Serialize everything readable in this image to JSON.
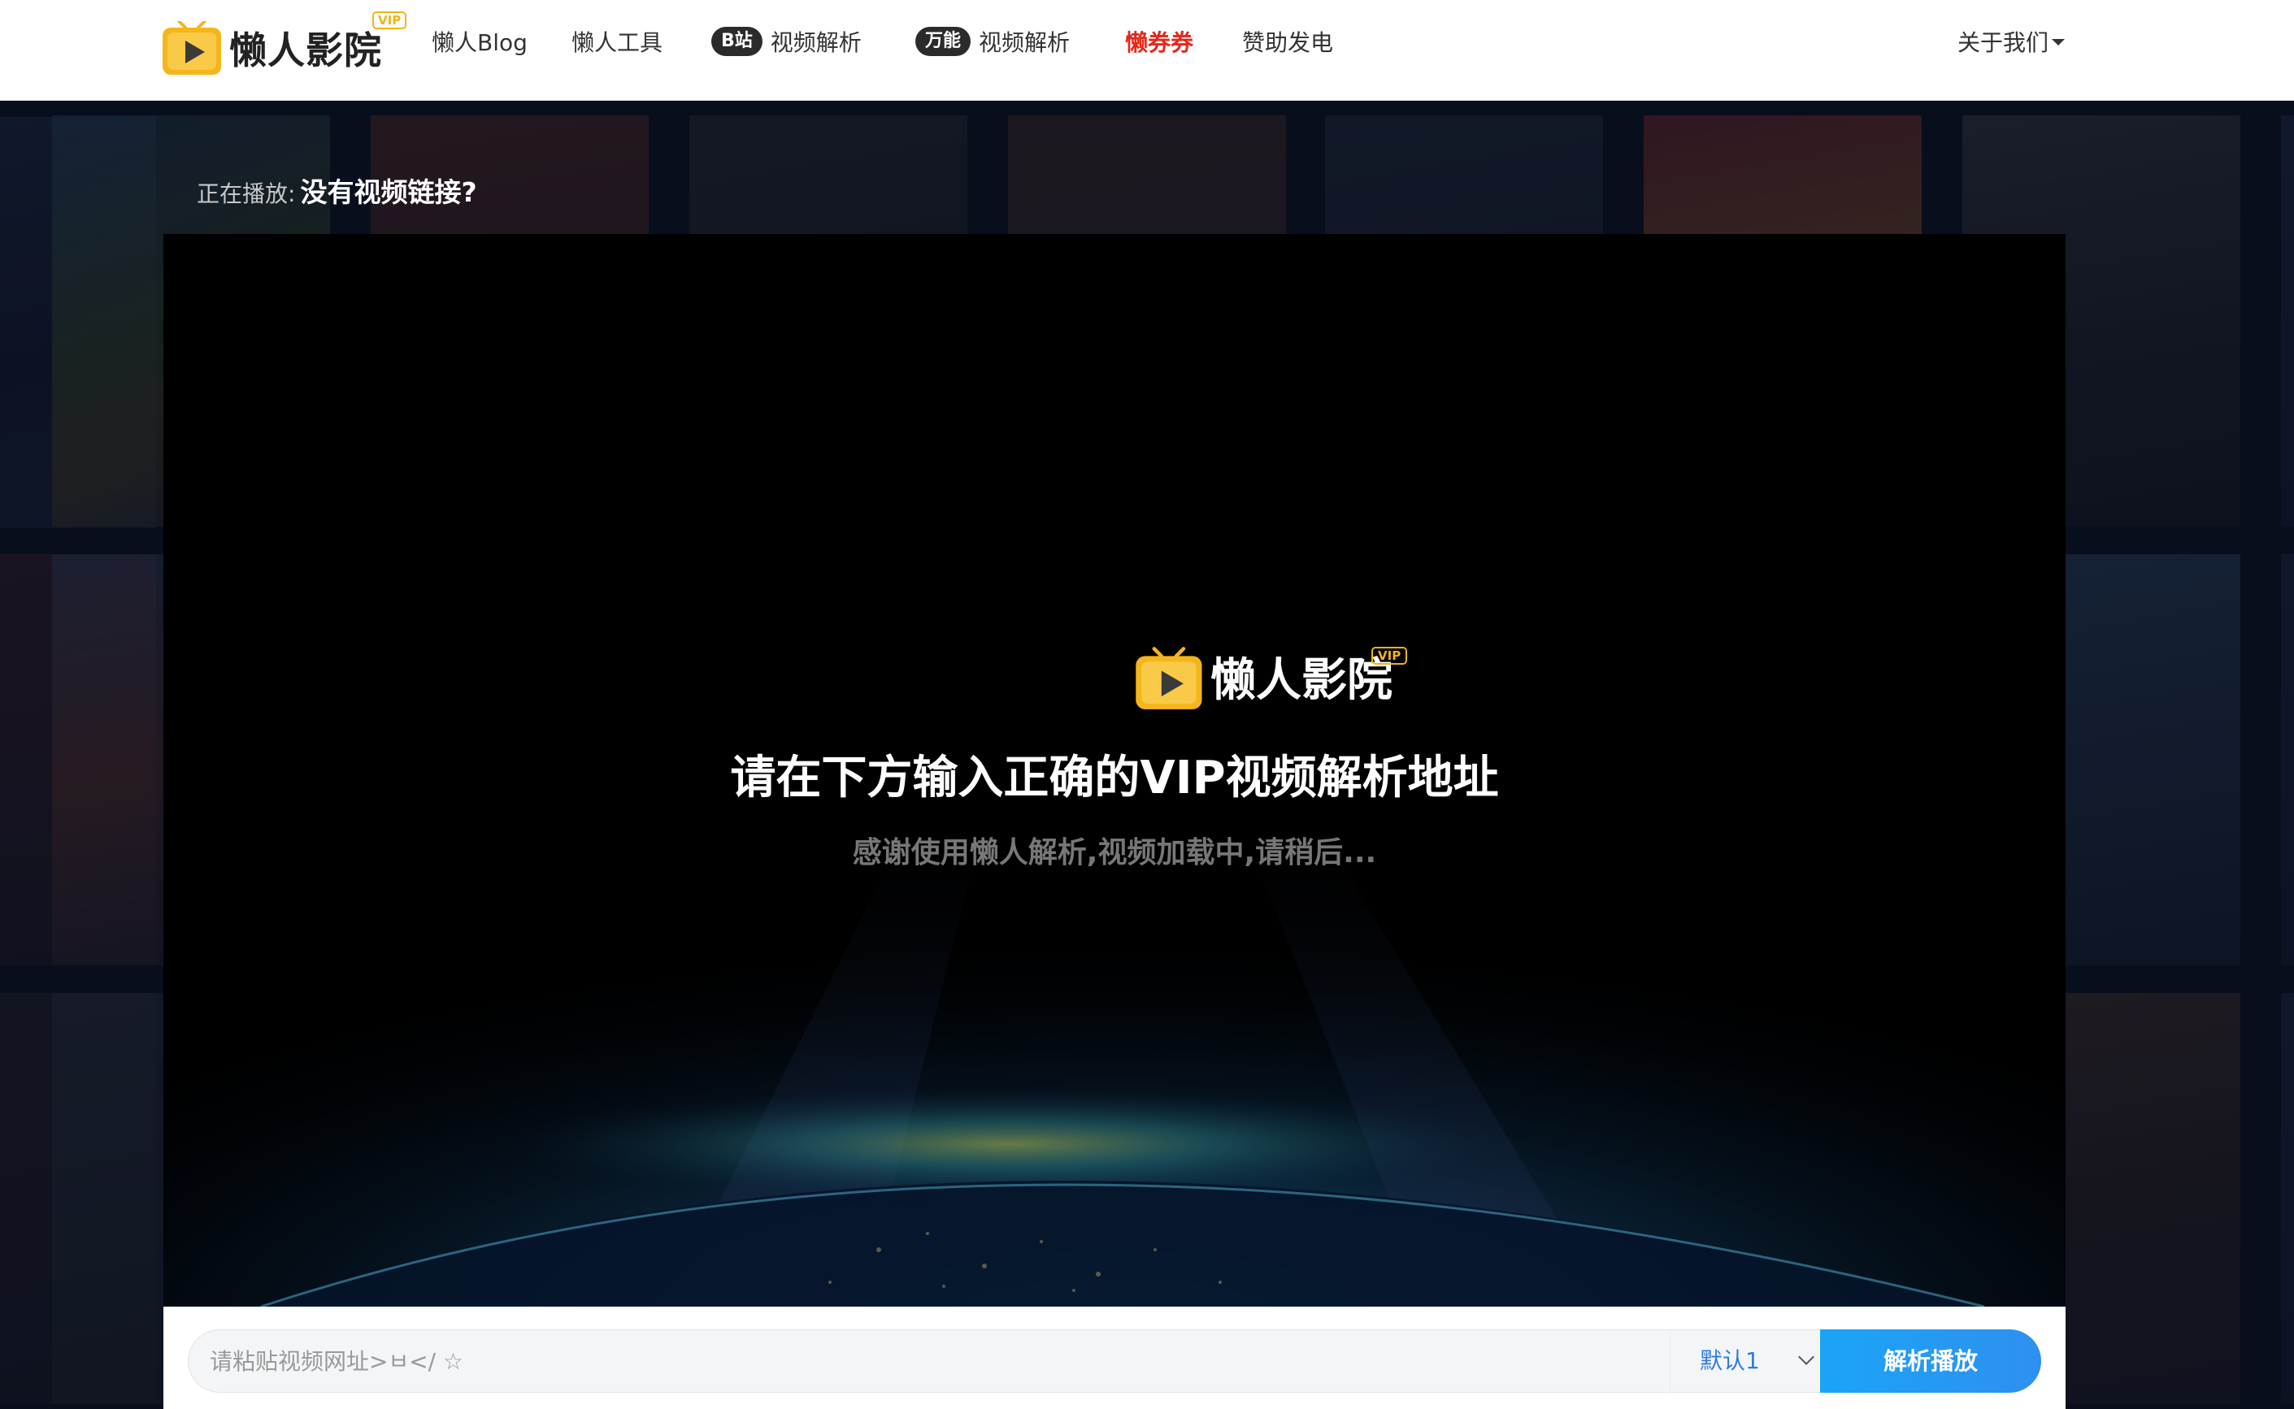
{
  "header": {
    "logo_text": "懒人影院",
    "logo_badge": "VIP",
    "nav": [
      {
        "label": "懒人Blog"
      },
      {
        "label": "懒人工具"
      },
      {
        "badge": "B站",
        "label": "视频解析"
      },
      {
        "badge": "万能",
        "label": "视频解析"
      },
      {
        "label": "懒券券",
        "highlight_color": "#e8261a"
      },
      {
        "label": "赞助发电"
      }
    ],
    "about": "关于我们"
  },
  "now_playing": {
    "prefix": "正在播放:",
    "title": "没有视频链接?"
  },
  "player": {
    "logo_text": "懒人影院",
    "logo_badge": "VIP",
    "heading": "请在下方输入正确的VIP视频解析地址",
    "subtext": "感谢使用懒人解析,视频加载中,请稍后..."
  },
  "search": {
    "placeholder": "请粘贴视频网址>ㅂ</ ☆",
    "value": "",
    "line_selected": "默认1",
    "button_label": "解析播放"
  },
  "colors": {
    "accent": "#1aa5f6",
    "logo_yellow": "#f5b51b",
    "hot_red": "#e8261a"
  }
}
